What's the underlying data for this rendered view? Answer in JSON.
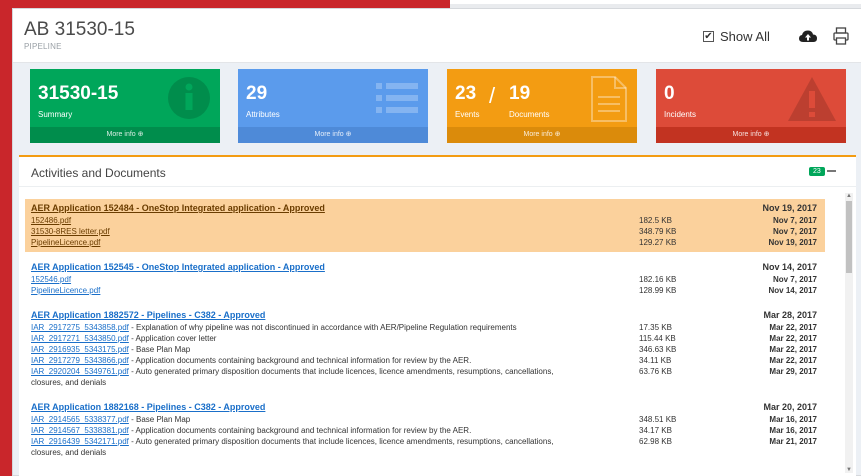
{
  "header": {
    "title": "AB 31530-15",
    "subtitle": "PIPELINE",
    "show_all_label": "Show All",
    "show_all_checked": "✔"
  },
  "boxes": {
    "summary": {
      "value": "31530-15",
      "label": "Summary",
      "more": "More info ⊕"
    },
    "attributes": {
      "value": "29",
      "label": "Attributes",
      "more": "More info ⊕"
    },
    "events_docs": {
      "events_value": "23",
      "events_label": "Events",
      "slash": "/",
      "docs_value": "19",
      "docs_label": "Documents",
      "more": "More info ⊕"
    },
    "incidents": {
      "value": "0",
      "label": "Incidents",
      "more": "More info ⊕"
    }
  },
  "activity": {
    "title": "Activities and Documents",
    "badge": "23",
    "groups": [
      {
        "title": "AER Application 152484 - OneStop Integrated application - Approved",
        "date": "Nov 19, 2017",
        "highlight": true,
        "docs": [
          {
            "file": "152486.pdf",
            "desc": "",
            "size": "182.5 KB",
            "date": "Nov 7, 2017"
          },
          {
            "file": "31530-8RES letter.pdf",
            "desc": "",
            "size": "348.79 KB",
            "date": "Nov 7, 2017"
          },
          {
            "file": "PipelineLicence.pdf",
            "desc": "",
            "size": "129.27 KB",
            "date": "Nov 19, 2017"
          }
        ]
      },
      {
        "title": "AER Application 152545 - OneStop Integrated application - Approved",
        "date": "Nov 14, 2017",
        "docs": [
          {
            "file": "152546.pdf",
            "desc": "",
            "size": "182.16 KB",
            "date": "Nov 7, 2017"
          },
          {
            "file": "PipelineLicence.pdf",
            "desc": "",
            "size": "128.99 KB",
            "date": "Nov 14, 2017"
          }
        ]
      },
      {
        "title": "AER Application 1882572 - Pipelines - C382 - Approved",
        "date": "Mar 28, 2017",
        "docs": [
          {
            "file": "IAR_2917275_5343858.pdf",
            "desc": " - Explanation of why pipeline was not discontinued in accordance with AER/Pipeline Regulation requirements",
            "size": "17.35 KB",
            "date": "Mar 22, 2017"
          },
          {
            "file": "IAR_2917271_5343850.pdf",
            "desc": " - Application cover letter",
            "size": "115.44 KB",
            "date": "Mar 22, 2017"
          },
          {
            "file": "IAR_2916935_5343175.pdf",
            "desc": " - Base Plan Map",
            "size": "346.63 KB",
            "date": "Mar 22, 2017"
          },
          {
            "file": "IAR_2917279_5343866.pdf",
            "desc": " - Application documents containing background and technical information for review by the AER.",
            "size": "34.11 KB",
            "date": "Mar 22, 2017"
          },
          {
            "file": "IAR_2920204_5349761.pdf",
            "desc": " - Auto generated primary disposition documents that include licences, licence amendments, resumptions, cancellations,",
            "desc2": "closures, and denials",
            "size": "63.76 KB",
            "date": "Mar 29, 2017"
          }
        ]
      },
      {
        "title": "AER Application 1882168 - Pipelines - C382 - Approved",
        "date": "Mar 20, 2017",
        "docs": [
          {
            "file": "IAR_2914565_5338377.pdf",
            "desc": " - Base Plan Map",
            "size": "348.51 KB",
            "date": "Mar 16, 2017"
          },
          {
            "file": "IAR_2914567_5338381.pdf",
            "desc": " - Application documents containing background and technical information for review by the AER.",
            "size": "34.17 KB",
            "date": "Mar 16, 2017"
          },
          {
            "file": "IAR_2916439_5342171.pdf",
            "desc": " - Auto generated primary disposition documents that include licences, licence amendments, resumptions, cancellations,",
            "desc2": "closures, and denials",
            "size": "62.98 KB",
            "date": "Mar 21, 2017"
          }
        ]
      }
    ]
  },
  "colors": {
    "summary": "#00a65a",
    "attributes": "#5b9bec",
    "events": "#f39c12",
    "incidents": "#dd4b39",
    "highlight": "#fbd19c",
    "link": "#1a6fc9"
  },
  "icons": {
    "summary": "info-icon",
    "attributes": "list-icon",
    "events": "document-icon",
    "incidents": "warning-icon",
    "cloud": "cloud-upload-icon",
    "print": "print-icon",
    "collapse": "minus-icon"
  }
}
